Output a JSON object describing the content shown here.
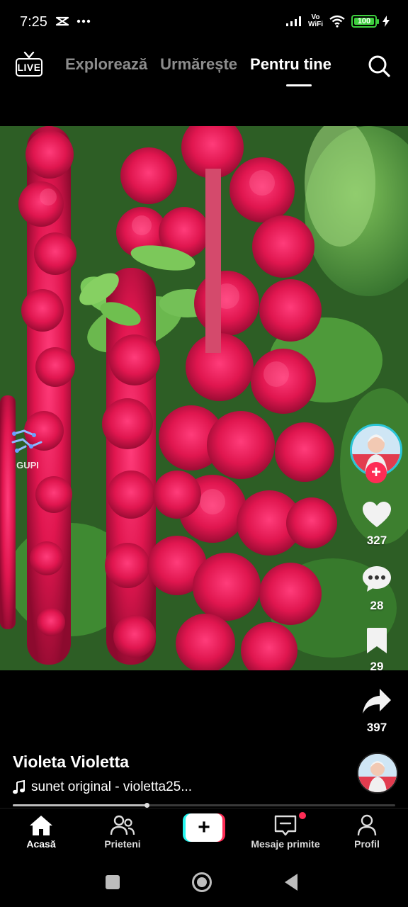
{
  "status_bar": {
    "time": "7:25",
    "network_label_top": "Vo",
    "network_label_bottom": "WiFi",
    "battery": "100",
    "battery_color": "#3ecf3e"
  },
  "top_nav": {
    "live_label": "LIVE",
    "tabs": [
      {
        "label": "Explorează",
        "active": false
      },
      {
        "label": "Urmărește",
        "active": false
      },
      {
        "label": "Pentru tine",
        "active": true
      }
    ],
    "search_icon": "search-icon"
  },
  "video": {
    "watermark": "GUPI",
    "subject": "red amaranth flowers"
  },
  "actions": {
    "likes": "327",
    "comments": "28",
    "saves": "29",
    "shares": "397",
    "follow_icon": "plus-icon",
    "accent_color": "#fe2c55",
    "avatar_ring_color": "#2bc4d6"
  },
  "caption": {
    "author": "Violeta Violetta",
    "sound": "sunet original - violetta25..."
  },
  "progress": 0.35,
  "tab_bar": {
    "tabs": [
      {
        "label": "Acasă",
        "icon": "home-icon",
        "active": true
      },
      {
        "label": "Prieteni",
        "icon": "friends-icon",
        "active": false
      },
      {
        "label": "",
        "icon": "create-plus-icon",
        "active": false
      },
      {
        "label": "Mesaje primite",
        "icon": "inbox-icon",
        "active": false
      },
      {
        "label": "Profil",
        "icon": "profile-icon",
        "active": false
      }
    ],
    "create_symbol": "+"
  },
  "system_nav": [
    "recents-icon",
    "home-circle-icon",
    "back-icon"
  ]
}
